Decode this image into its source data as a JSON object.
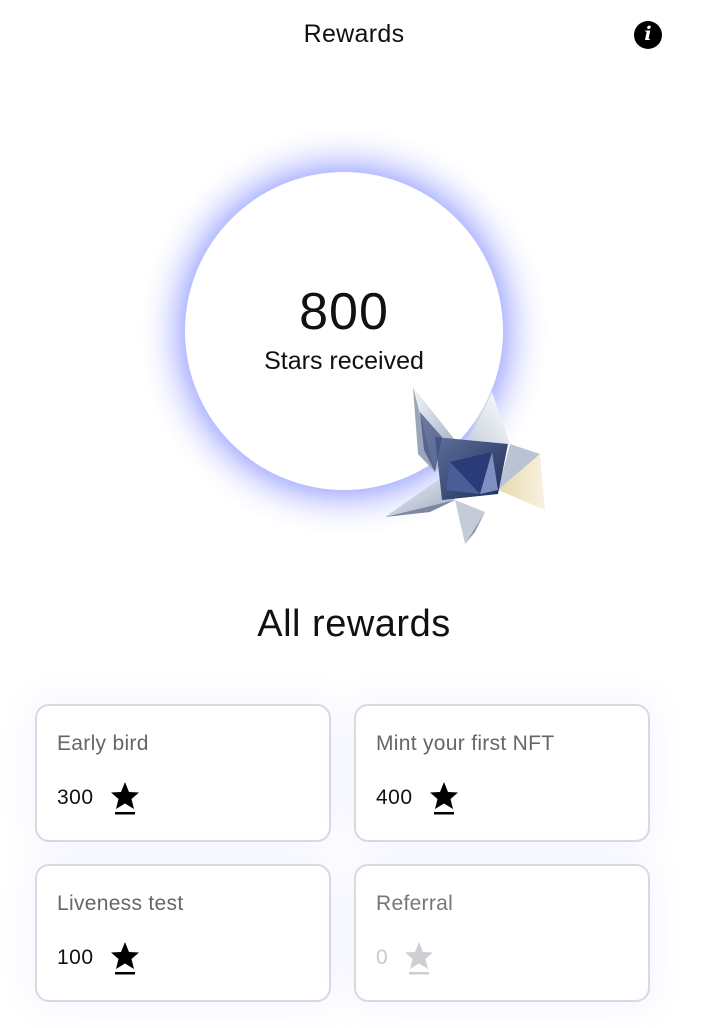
{
  "header": {
    "title": "Rewards",
    "info_icon": "info-icon"
  },
  "hero": {
    "stars_count": "800",
    "stars_label": "Stars received",
    "glow_color": "#6f7cff"
  },
  "rewards": {
    "title": "All rewards",
    "cards": [
      {
        "title": "Early bird",
        "value": "300",
        "icon": "star-icon",
        "active": true
      },
      {
        "title": "Mint your first NFT",
        "value": "400",
        "icon": "star-icon",
        "active": true
      },
      {
        "title": "Liveness test",
        "value": "100",
        "icon": "star-icon",
        "active": true
      },
      {
        "title": "Referral",
        "value": "0",
        "icon": "star-icon",
        "active": false
      }
    ]
  },
  "colors": {
    "star_active": "#000000",
    "star_inactive": "#cfcfd3",
    "card_border": "#d9d9de"
  }
}
